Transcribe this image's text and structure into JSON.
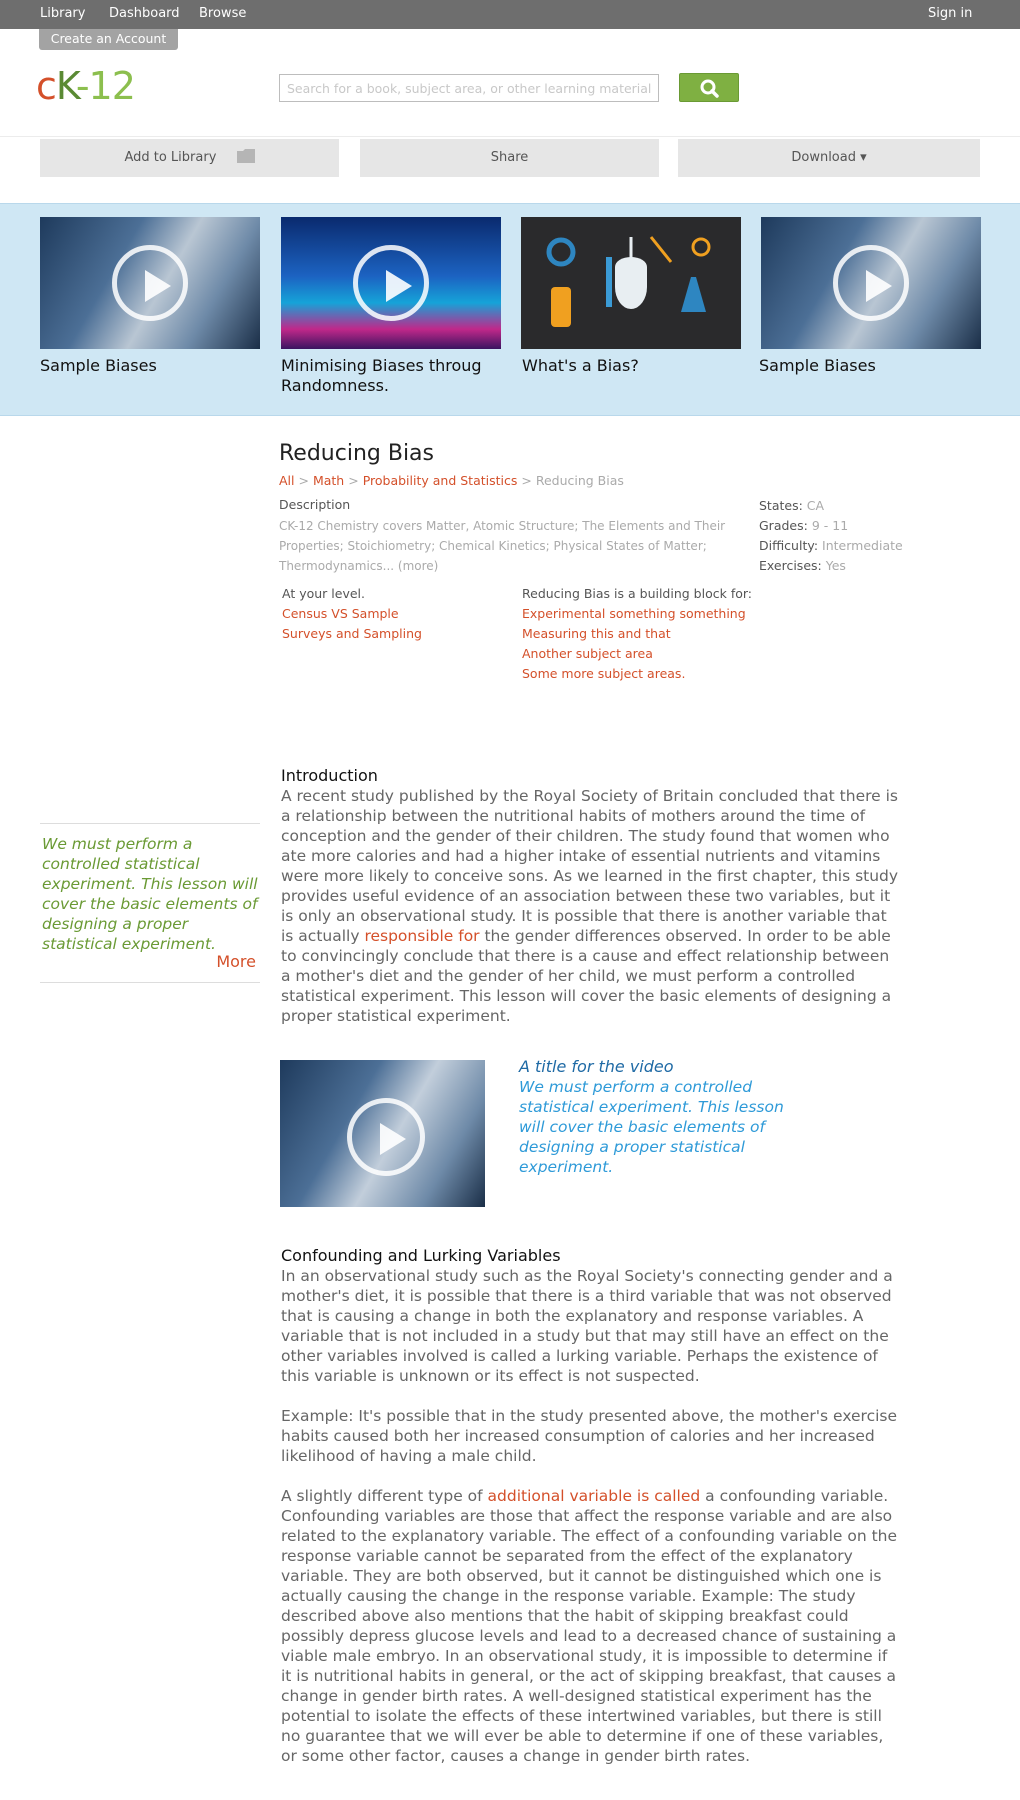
{
  "nav": {
    "library": "Library",
    "dashboard": "Dashboard",
    "browse": "Browse",
    "sign_in": "Sign in",
    "create_account": "Create an Account"
  },
  "logo": {
    "c": "c",
    "k": "K",
    "num": "-12"
  },
  "search": {
    "placeholder": "Search for a book, subject area, or other learning materials"
  },
  "actions": {
    "add": "Add to Library",
    "share": "Share",
    "download": "Download ▾"
  },
  "videos": [
    {
      "title": "Sample Biases",
      "icon": "play-icon"
    },
    {
      "title": "Minimising Biases throug Randomness.",
      "icon": "play-icon"
    },
    {
      "title": "What's a Bias?",
      "icon": "mouse-icon"
    },
    {
      "title": "Sample Biases",
      "icon": "play-icon"
    }
  ],
  "lesson": {
    "title": "Reducing Bias",
    "breadcrumb": {
      "all": "All",
      "math": "Math",
      "prob": "Probability and Statistics",
      "current": "Reducing Bias",
      "sep": ">"
    },
    "description_label": "Description",
    "description": "CK-12 Chemistry covers Matter, Atomic Structure; The Elements and Their Properties; Stoichiometry; Chemical Kinetics; Physical States of Matter; Thermodynamics... (more)"
  },
  "meta": {
    "states_label": "States:",
    "states": "CA",
    "grades_label": "Grades:",
    "grades": "9 - 11",
    "difficulty_label": "Difficulty:",
    "difficulty": "Intermediate",
    "exercises_label": "Exercises:",
    "exercises": "Yes"
  },
  "related": {
    "level_label": "At your level.",
    "level_links": [
      "Census VS Sample",
      "Surveys and Sampling"
    ],
    "block_label": "Reducing Bias is a building block for:",
    "block_links": [
      "Experimental something something",
      "Measuring this and that",
      "Another subject area",
      "Some more subject areas."
    ]
  },
  "sidebar": {
    "text": "We must perform a controlled statistical experiment. This lesson will cover the basic elements of designing a proper statistical experiment.",
    "more": "More"
  },
  "intro": {
    "heading": "Introduction",
    "p1_a": "A recent study published by the Royal Society of Britain concluded that there is a relationship between the nutritional habits of mothers around the time of conception and the gender of their children. The study found that women who ate more calories and had a higher intake of essential nutrients and vitamins were more likely to conceive sons. As we learned in the first chapter, this study provides useful evidence of an association between these two variables, but it is only an observational study. It is possible that there is another variable that is actually ",
    "p1_link": "responsible for",
    "p1_b": " the gender differences observed. In order to be able to convincingly conclude that there is a cause and effect relationship between a mother's diet and the gender of her child, we must perform a controlled statistical experiment. This lesson will cover the basic elements of designing a proper statistical experiment."
  },
  "video_feature": {
    "title": "A title for the video",
    "desc": "We must perform a controlled statistical experiment. This lesson will cover the basic elements of designing a proper statistical experiment."
  },
  "confounding": {
    "heading": "Confounding and Lurking Variables",
    "p1": "In an observational study such as the Royal Society's connecting gender and a mother's diet, it is possible that there is a third variable that was not observed that is causing a change in both the explanatory and response variables. A variable that is not included in a study but that may still have an effect on the other variables involved is called a lurking variable. Perhaps the existence of this variable is unknown or its effect is not suspected.",
    "p2": "Example: It's possible that in the study presented above, the mother's exercise habits caused both her increased consumption of calories and her increased likelihood of having a male child.",
    "p3_a": "A slightly different type of ",
    "p3_link": "additional variable is called",
    "p3_b": " a confounding variable. Confounding variables are those that affect the response variable and are also related to the explanatory variable. The effect of a confounding variable on the response variable cannot be separated from the effect of the explanatory variable. They are both observed, but it cannot be distinguished which one is actually causing the change in the response variable. Example: The study described above also mentions that the habit of skipping breakfast could possibly depress glucose levels and lead to a decreased chance of sustaining a viable male embryo. In an observational study, it is impossible to determine if it is nutritional habits in general, or the act of skipping breakfast, that causes a change in gender birth rates. A well-designed statistical experiment has the potential to isolate the effects of these intertwined variables, but there is still no guarantee that we will ever be able to determine if one of these variables, or some other factor, causes a change in gender birth rates."
  }
}
